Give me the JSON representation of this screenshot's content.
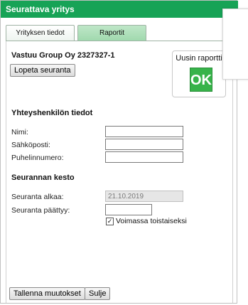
{
  "window": {
    "title": "Seurattava yritys"
  },
  "tabs": [
    {
      "label": "Yrityksen tiedot",
      "active": true
    },
    {
      "label": "Raportit",
      "active": false
    }
  ],
  "company": {
    "name": "Vastuu Group Oy 2327327-1",
    "stop_button": "Lopeta seuranta"
  },
  "report": {
    "label": "Uusin raportti",
    "status": "OK",
    "status_color": "#37b34a"
  },
  "contact": {
    "heading": "Yhteyshenkilön tiedot",
    "name_label": "Nimi:",
    "name_value": "",
    "email_label": "Sähköposti:",
    "email_value": "",
    "phone_label": "Puhelinnumero:",
    "phone_value": ""
  },
  "monitoring": {
    "heading": "Seurannan kesto",
    "start_label": "Seuranta alkaa:",
    "start_value": "21.10.2019",
    "end_label": "Seuranta päättyy:",
    "end_value": "",
    "indefinite_label": "Voimassa toistaiseksi",
    "indefinite_checked": true
  },
  "footer": {
    "save_label": "Tallenna muutokset",
    "close_label": "Sulje"
  },
  "colors": {
    "titlebar": "#17a356",
    "tab_inactive": "#a8dcb3"
  }
}
